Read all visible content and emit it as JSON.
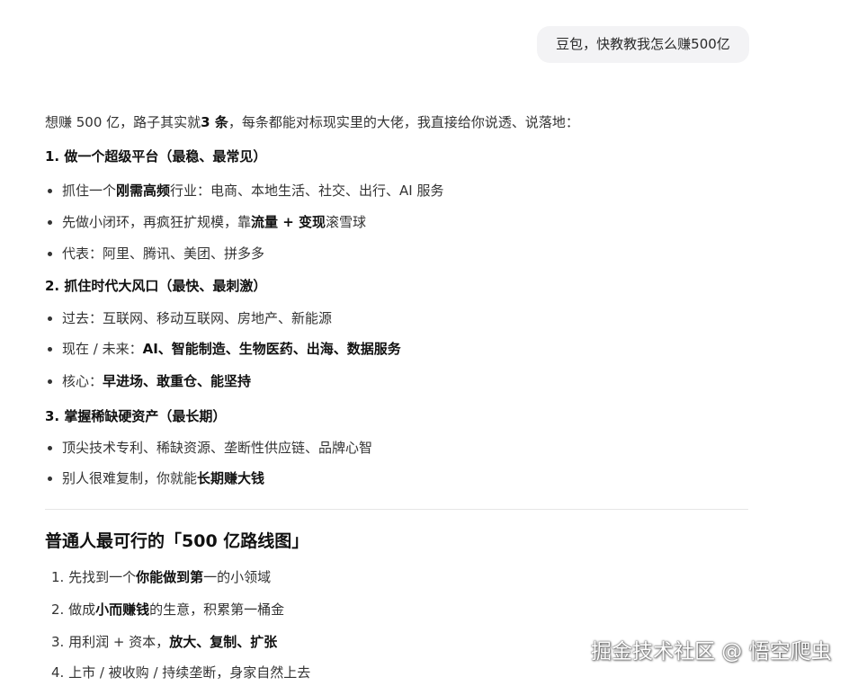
{
  "user_message": {
    "text": "豆包，快教教我怎么赚500亿"
  },
  "answer": {
    "intro": {
      "a": "想赚 500 亿，路子其实就",
      "b": "3 条",
      "c": "，每条都能对标现实里的大佬，我直接给你说透、说落地："
    },
    "sections": [
      {
        "heading": "1. 做一个超级平台（最稳、最常见）",
        "bullets": [
          {
            "a": "抓住一个",
            "b": "刚需高频",
            "c": "行业：电商、本地生活、社交、出行、AI 服务"
          },
          {
            "a": "先做小闭环，再疯狂扩规模，靠",
            "b": "流量 + 变现",
            "c": "滚雪球"
          },
          {
            "a": "代表：阿里、腾讯、美团、拼多多",
            "b": "",
            "c": ""
          }
        ]
      },
      {
        "heading": "2. 抓住时代大风口（最快、最刺激）",
        "bullets": [
          {
            "a": "过去：互联网、移动互联网、房地产、新能源",
            "b": "",
            "c": ""
          },
          {
            "a": "现在 / 未来：",
            "b": "AI、智能制造、生物医药、出海、数据服务",
            "c": ""
          },
          {
            "a": "核心：",
            "b": "早进场、敢重仓、能坚持",
            "c": ""
          }
        ]
      },
      {
        "heading": "3. 掌握稀缺硬资产（最长期）",
        "bullets": [
          {
            "a": "顶尖技术专利、稀缺资源、垄断性供应链、品牌心智",
            "b": "",
            "c": ""
          },
          {
            "a": "别人很难复制，你就能",
            "b": "长期赚大钱",
            "c": ""
          }
        ]
      }
    ],
    "roadmap": {
      "title": "普通人最可行的「500 亿路线图」",
      "steps": [
        {
          "a": "1. 先找到一个",
          "b": "你能做到第",
          "c": "一的小领域"
        },
        {
          "a": "2. 做成",
          "b": "小而赚钱",
          "c": "的生意，积累第一桶金"
        },
        {
          "a": "3. 用利润 + 资本，",
          "b": "放大、复制、扩张",
          "c": ""
        },
        {
          "a": "4. 上市 / 被收购 / 持续垄断，身家自然上去",
          "b": "",
          "c": ""
        }
      ]
    }
  },
  "watermark": {
    "text": "掘金技术社区 @ 悟空爬虫"
  }
}
